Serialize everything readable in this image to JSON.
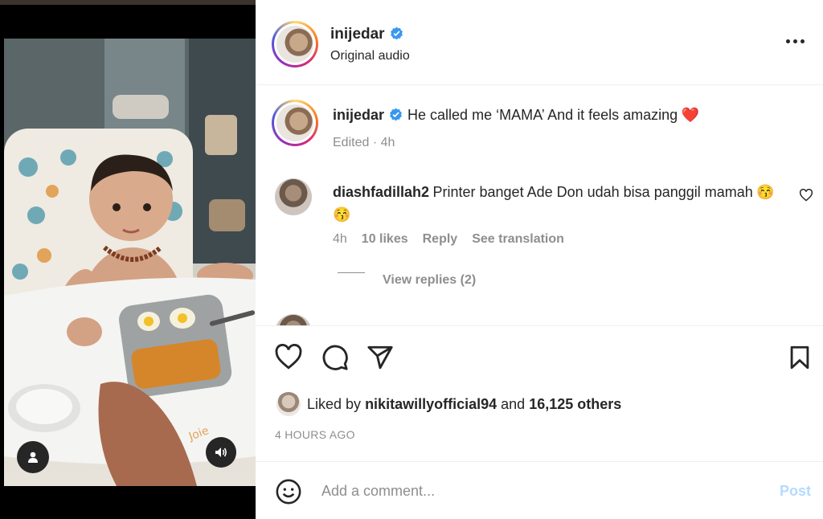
{
  "post": {
    "username": "inijedar",
    "audio": "Original audio",
    "caption": "He called me ‘MAMA’ And it feels amazing",
    "caption_emoji": "❤️",
    "caption_meta": "Edited · 4h"
  },
  "comments": [
    {
      "username": "diashfadillah2",
      "text": "Printer banget Ade Don udah bisa panggil mamah",
      "emoji": "😚 😚",
      "time": "4h",
      "likes": "10 likes",
      "reply_label": "Reply",
      "translate_label": "See translation",
      "view_replies": "View replies (2)"
    }
  ],
  "likes": {
    "prefix": "Liked by",
    "user": "nikitawillyofficial94",
    "middle": "and",
    "count": "16,125 others"
  },
  "timestamp": "4 HOURS AGO",
  "add_comment": {
    "placeholder": "Add a comment...",
    "post_label": "Post"
  },
  "icons": {
    "more": "more-options-icon",
    "like": "heart-icon",
    "comment": "comment-icon",
    "share": "share-icon",
    "save": "bookmark-icon",
    "emoji": "emoji-icon",
    "tag": "user-tag-icon",
    "sound": "sound-icon",
    "verified": "verified-badge-icon"
  },
  "colors": {
    "verified": "#3897f0",
    "post_disabled": "#b3dbff",
    "heart": "#ed4956"
  }
}
